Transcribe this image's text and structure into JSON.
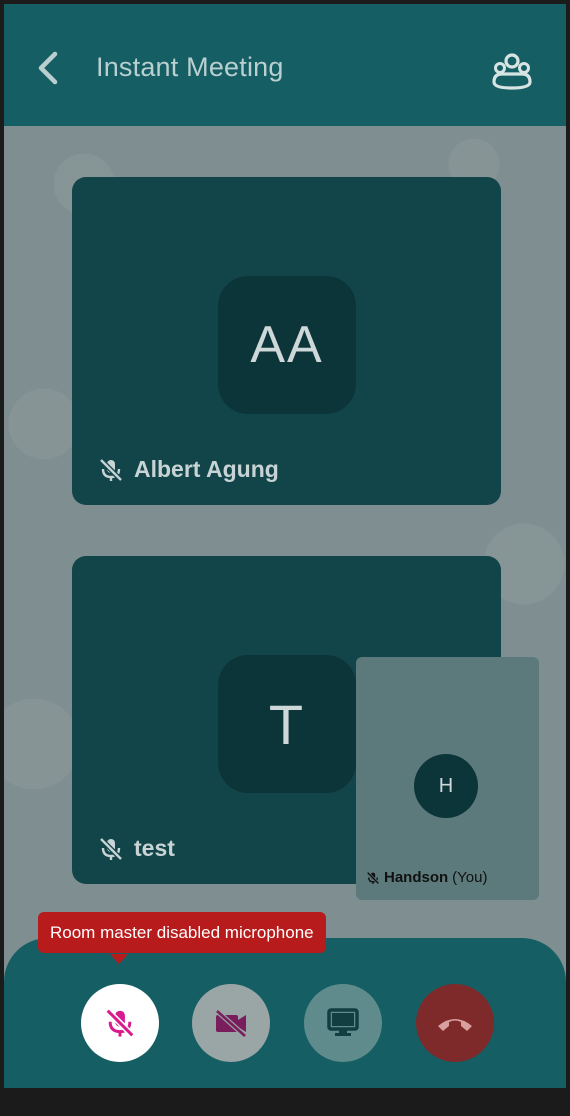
{
  "header": {
    "title": "Instant Meeting",
    "back_icon": "chevron-left-icon",
    "participants_icon": "participants-icon"
  },
  "tiles": [
    {
      "initials": "AA",
      "name": "Albert Agung",
      "mic": "muted"
    },
    {
      "initials": "T",
      "name": "test",
      "mic": "muted"
    }
  ],
  "self_view": {
    "initials": "H",
    "name": "Handson",
    "suffix": "(You)",
    "mic": "muted"
  },
  "tooltip": {
    "text": "Room master disabled microphone"
  },
  "controls": {
    "mic_icon": "mic-off-icon",
    "camera_icon": "video-off-icon",
    "screen_icon": "screen-share-icon",
    "end_icon": "end-call-icon"
  },
  "colors": {
    "header_bg": "#155e63",
    "tile_bg": "#124549",
    "avatar_bg": "#0c3539",
    "tooltip_bg": "#b81b1b",
    "mic_off_accent": "#d81b8c",
    "end_call": "#7f2a2a"
  }
}
